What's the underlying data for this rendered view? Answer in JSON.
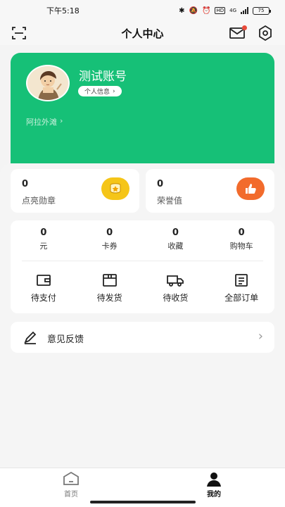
{
  "status_bar": {
    "time": "下午5:18",
    "network": "4G",
    "battery": "75"
  },
  "header": {
    "title": "个人中心",
    "icons": [
      "scan-icon",
      "mail-icon",
      "settings-icon"
    ]
  },
  "profile": {
    "username": "测试账号",
    "info_button": "个人信息",
    "location": "阿拉外滩",
    "avatar": "avatar-illustration"
  },
  "stats": [
    {
      "value": "0",
      "label": "点亮勋章",
      "icon": "medal-icon",
      "color": "#f5c518"
    },
    {
      "value": "0",
      "label": "荣誉值",
      "icon": "thumbs-up-icon",
      "color": "#f26b2c"
    }
  ],
  "metrics": [
    {
      "value": "0",
      "label": "元"
    },
    {
      "value": "0",
      "label": "卡券"
    },
    {
      "value": "0",
      "label": "收藏"
    },
    {
      "value": "0",
      "label": "购物车"
    }
  ],
  "orders": [
    {
      "label": "待支付",
      "icon": "wallet-icon"
    },
    {
      "label": "待发货",
      "icon": "package-icon"
    },
    {
      "label": "待收货",
      "icon": "truck-icon"
    },
    {
      "label": "全部订单",
      "icon": "orders-list-icon"
    }
  ],
  "feedback": {
    "label": "意见反馈",
    "icon": "edit-icon"
  },
  "bottom_nav": [
    {
      "label": "首页",
      "icon": "home-icon",
      "active": false
    },
    {
      "label": "我的",
      "icon": "user-icon",
      "active": true
    }
  ],
  "colors": {
    "accent": "#16c077",
    "badge_yellow": "#f5c518",
    "badge_orange": "#f26b2c"
  }
}
